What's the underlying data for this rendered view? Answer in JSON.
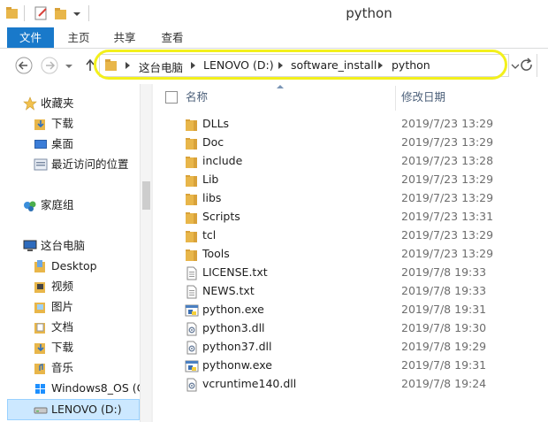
{
  "window": {
    "title": "python"
  },
  "ribbon": {
    "tabs": [
      "文件",
      "主页",
      "共享",
      "查看"
    ]
  },
  "address": {
    "crumbs": [
      "这台电脑",
      "LENOVO (D:)",
      "software_install",
      "python"
    ]
  },
  "nav": {
    "items": [
      {
        "label": "收藏夹",
        "icon": "star-icon"
      },
      {
        "label": "下载",
        "icon": "downloads-folder-icon"
      },
      {
        "label": "桌面",
        "icon": "desktop-icon"
      },
      {
        "label": "最近访问的位置",
        "icon": "recent-places-icon"
      },
      {
        "label": "家庭组",
        "icon": "homegroup-icon"
      },
      {
        "label": "这台电脑",
        "icon": "computer-icon"
      },
      {
        "label": "Desktop",
        "icon": "folder-icon"
      },
      {
        "label": "视频",
        "icon": "videos-folder-icon"
      },
      {
        "label": "图片",
        "icon": "pictures-folder-icon"
      },
      {
        "label": "文档",
        "icon": "documents-folder-icon"
      },
      {
        "label": "下载",
        "icon": "downloads-folder-icon"
      },
      {
        "label": "音乐",
        "icon": "music-folder-icon"
      },
      {
        "label": "Windows8_OS (C",
        "icon": "windows-drive-icon"
      },
      {
        "label": "LENOVO (D:)",
        "icon": "drive-icon"
      }
    ]
  },
  "columns": {
    "name": "名称",
    "modified": "修改日期"
  },
  "files": [
    {
      "name": "DLLs",
      "date": "2019/7/23 13:29",
      "type": "folder"
    },
    {
      "name": "Doc",
      "date": "2019/7/23 13:29",
      "type": "folder"
    },
    {
      "name": "include",
      "date": "2019/7/23 13:28",
      "type": "folder"
    },
    {
      "name": "Lib",
      "date": "2019/7/23 13:29",
      "type": "folder"
    },
    {
      "name": "libs",
      "date": "2019/7/23 13:29",
      "type": "folder"
    },
    {
      "name": "Scripts",
      "date": "2019/7/23 13:31",
      "type": "folder"
    },
    {
      "name": "tcl",
      "date": "2019/7/23 13:29",
      "type": "folder"
    },
    {
      "name": "Tools",
      "date": "2019/7/23 13:29",
      "type": "folder"
    },
    {
      "name": "LICENSE.txt",
      "date": "2019/7/8 19:33",
      "type": "text"
    },
    {
      "name": "NEWS.txt",
      "date": "2019/7/8 19:33",
      "type": "text"
    },
    {
      "name": "python.exe",
      "date": "2019/7/8 19:31",
      "type": "python-exe"
    },
    {
      "name": "python3.dll",
      "date": "2019/7/8 19:30",
      "type": "dll"
    },
    {
      "name": "python37.dll",
      "date": "2019/7/8 19:29",
      "type": "dll"
    },
    {
      "name": "pythonw.exe",
      "date": "2019/7/8 19:31",
      "type": "pythonw-exe"
    },
    {
      "name": "vcruntime140.dll",
      "date": "2019/7/8 19:24",
      "type": "dll"
    }
  ],
  "colors": {
    "accent": "#1979ca",
    "selection": "#cce8ff",
    "highlight_ring": "#f3f01c",
    "folder": "#e8b64a"
  }
}
